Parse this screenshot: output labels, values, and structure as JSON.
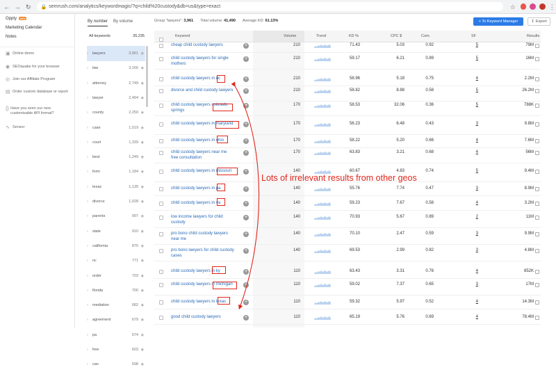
{
  "browser": {
    "url": "semrush.com/analytics/keywordmagic/?q=child%20custody&db=us&type=exact"
  },
  "sidebar": {
    "top_items": [
      {
        "label": "Oppty",
        "badge": "new"
      },
      {
        "label": "Marketing Calendar"
      },
      {
        "label": "Notes"
      }
    ],
    "tools": [
      {
        "label": "Online demo",
        "icon": "monitor-icon"
      },
      {
        "label": "SEOquake for your browser",
        "icon": "seoquake-icon"
      },
      {
        "label": "Join our Affiliate Program",
        "icon": "affiliate-icon"
      },
      {
        "label": "Order custom database or report",
        "icon": "database-icon"
      },
      {
        "label": "Have you seen our new customisable API format?",
        "icon": "api-icon"
      },
      {
        "label": "Sensor",
        "icon": "sensor-icon"
      }
    ]
  },
  "groups": {
    "tabs": [
      "By number",
      "By volume"
    ],
    "header_label": "All keywords",
    "header_count": "35,235",
    "items": [
      {
        "name": "lawyers",
        "count": "3,961"
      },
      {
        "name": "law",
        "count": "3,166"
      },
      {
        "name": "attorney",
        "count": "2,749"
      },
      {
        "name": "lawyer",
        "count": "2,494"
      },
      {
        "name": "county",
        "count": "2,250"
      },
      {
        "name": "case",
        "count": "1,519"
      },
      {
        "name": "court",
        "count": "1,339"
      },
      {
        "name": "best",
        "count": "1,249"
      },
      {
        "name": "form",
        "count": "1,184"
      },
      {
        "name": "texas",
        "count": "1,135"
      },
      {
        "name": "divorce",
        "count": "1,028"
      },
      {
        "name": "parents",
        "count": "997"
      },
      {
        "name": "state",
        "count": "910"
      },
      {
        "name": "california",
        "count": "870"
      },
      {
        "name": "nc",
        "count": "771"
      },
      {
        "name": "order",
        "count": "703"
      },
      {
        "name": "florida",
        "count": "700"
      },
      {
        "name": "mediation",
        "count": "682"
      },
      {
        "name": "agreement",
        "count": "679"
      },
      {
        "name": "pa",
        "count": "674"
      },
      {
        "name": "free",
        "count": "603"
      },
      {
        "name": "can",
        "count": "598"
      }
    ]
  },
  "stats": {
    "group_label": "Group \"lawyers\":",
    "group_value": "3,961",
    "total_label": "Total volume:",
    "total_value": "41,490",
    "kd_label": "Average KD:",
    "kd_value": "61.13%"
  },
  "buttons": {
    "keyword_manager": "+ To Keyword Manager",
    "export": "Export"
  },
  "table": {
    "columns": {
      "keyword": "Keyword",
      "volume": "Volume",
      "trend": "Trend",
      "kd": "KD %",
      "cpc": "CPC $",
      "com": "Com.",
      "sf": "SF",
      "results": "Results"
    },
    "rows": [
      {
        "keyword": "cheap child custody lawyers",
        "volume": "210",
        "kd": "71.43",
        "cpc": "5.03",
        "com": "0.92",
        "sf": "5",
        "results": "79M"
      },
      {
        "keyword": "child custody lawyers for single mothers",
        "volume": "210",
        "kd": "59.17",
        "cpc": "6.21",
        "com": "0.89",
        "sf": "5",
        "results": "16M"
      },
      {
        "keyword": "child custody lawyers in nc",
        "volume": "210",
        "kd": "58.96",
        "cpc": "5.18",
        "com": "0.75",
        "sf": "4",
        "results": "2.2M"
      },
      {
        "keyword": "divorce and child custody lawyers",
        "volume": "210",
        "kd": "58.82",
        "cpc": "8.88",
        "com": "0.58",
        "sf": "5",
        "results": "26.2M"
      },
      {
        "keyword": "child custody lawyers colorado springs",
        "volume": "170",
        "kd": "58.53",
        "cpc": "32.06",
        "com": "0.36",
        "sf": "5",
        "results": "788K"
      },
      {
        "keyword": "child custody lawyers in maryland",
        "volume": "170",
        "kd": "56.23",
        "cpc": "6.48",
        "com": "0.43",
        "sf": "3",
        "results": "9.8M"
      },
      {
        "keyword": "child custody lawyers in ohio",
        "volume": "170",
        "kd": "58.22",
        "cpc": "5.20",
        "com": "0.66",
        "sf": "4",
        "results": "7.6M"
      },
      {
        "keyword": "child custody lawyers near me free consultation",
        "volume": "170",
        "kd": "63.83",
        "cpc": "3.21",
        "com": "0.68",
        "sf": "4",
        "results": "56M"
      },
      {
        "keyword": "child custody lawyers in missouri",
        "volume": "140",
        "kd": "60.67",
        "cpc": "4.83",
        "com": "0.74",
        "sf": "5",
        "results": "9.4M"
      },
      {
        "keyword": "child custody lawyers in pa",
        "volume": "140",
        "kd": "55.76",
        "cpc": "7.74",
        "com": "0.47",
        "sf": "3",
        "results": "8.9M"
      },
      {
        "keyword": "child custody lawyers in va",
        "volume": "140",
        "kd": "59.23",
        "cpc": "7.67",
        "com": "0.58",
        "sf": "4",
        "results": "3.2M"
      },
      {
        "keyword": "low income lawyers for child custody",
        "volume": "140",
        "kd": "70.93",
        "cpc": "5.67",
        "com": "0.89",
        "sf": "2",
        "results": "11M"
      },
      {
        "keyword": "pro bono child custody lawyers near me",
        "volume": "140",
        "kd": "70.10",
        "cpc": "2.47",
        "com": "0.59",
        "sf": "3",
        "results": "9.9M"
      },
      {
        "keyword": "pro bono lawyers for child custody cases",
        "volume": "140",
        "kd": "69.53",
        "cpc": "2.99",
        "com": "0.82",
        "sf": "3",
        "results": "4.8M"
      },
      {
        "keyword": "child custody lawyers in ky",
        "volume": "110",
        "kd": "63.43",
        "cpc": "3.31",
        "com": "0.76",
        "sf": "4",
        "results": "852K"
      },
      {
        "keyword": "child custody lawyers in michigan",
        "volume": "110",
        "kd": "59.02",
        "cpc": "7.37",
        "com": "0.65",
        "sf": "3",
        "results": "17M"
      },
      {
        "keyword": "child custody lawyers in texas",
        "volume": "110",
        "kd": "59.32",
        "cpc": "5.97",
        "com": "0.52",
        "sf": "4",
        "results": "14.3M"
      },
      {
        "keyword": "good child custody lawyers",
        "volume": "110",
        "kd": "65.19",
        "cpc": "5.76",
        "com": "0.69",
        "sf": "4",
        "results": "78.4M"
      }
    ]
  },
  "annotation": {
    "text": "Lots of irrelevant results from other geos",
    "color": "#e0251b"
  },
  "colors": {
    "accent": "#2c7be5",
    "link": "#2a6ab6",
    "selected_group": "#dbe8f8"
  }
}
